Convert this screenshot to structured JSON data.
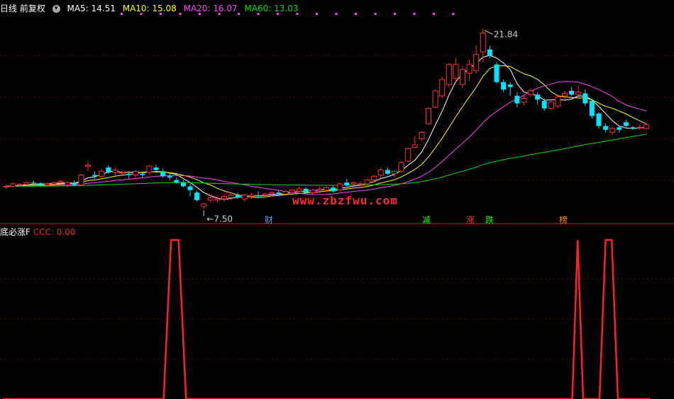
{
  "header": {
    "period_label": "日线 前复权",
    "menu_icon": "chevron-down-icon",
    "ma_labels": [
      {
        "label": "MA5: 14.51",
        "color": "#ffffff"
      },
      {
        "label": "MA10: 15.08",
        "color": "#ffff00"
      },
      {
        "label": "MA20: 16.07",
        "color": "#ff40ff"
      },
      {
        "label": "MA60: 13.03",
        "color": "#00dd00"
      }
    ]
  },
  "indicator": {
    "name": "底必涨F",
    "value_label": "CCC: 0.00",
    "value_color": "#ff2020"
  },
  "watermark": "www.zbzfwu.com",
  "events": [
    {
      "text": "财",
      "color": "#4da6ff"
    },
    {
      "text": "减",
      "color": "#00ff00"
    },
    {
      "text": "涨",
      "color": "#ff3030"
    },
    {
      "text": "跌",
      "color": "#00ff00"
    },
    {
      "text": "榜",
      "color": "#ff8c00"
    }
  ],
  "chart_data": [
    {
      "type": "candlestick",
      "title": "日线 前复权",
      "up_color": "#ff3030",
      "down_color": "#00e5ff",
      "ylim": [
        6.5,
        23
      ],
      "annotations": [
        {
          "label": "21.84",
          "type": "high"
        },
        {
          "label": "7.50",
          "type": "low"
        }
      ],
      "candles": [
        [
          9.3,
          9.45,
          9.1,
          9.3
        ],
        [
          9.3,
          9.6,
          9.2,
          9.5
        ],
        [
          9.4,
          9.55,
          9.3,
          9.45
        ],
        [
          9.45,
          9.7,
          9.35,
          9.6
        ],
        [
          9.6,
          9.75,
          9.45,
          9.55
        ],
        [
          9.5,
          9.65,
          9.3,
          9.4
        ],
        [
          9.4,
          9.6,
          9.3,
          9.5
        ],
        [
          9.5,
          9.7,
          9.4,
          9.6
        ],
        [
          9.6,
          9.8,
          9.5,
          9.7
        ],
        [
          9.4,
          9.7,
          9.2,
          9.6
        ],
        [
          9.6,
          9.8,
          9.3,
          9.4
        ],
        [
          9.4,
          10.3,
          9.3,
          10.2
        ],
        [
          10.9,
          11.3,
          10.5,
          11.0
        ],
        [
          10.2,
          10.5,
          9.9,
          10.1
        ],
        [
          10.1,
          10.7,
          10.0,
          10.5
        ],
        [
          10.8,
          11.0,
          10.3,
          10.4
        ],
        [
          10.4,
          10.8,
          10.0,
          10.6
        ],
        [
          10.4,
          10.6,
          10.1,
          10.4
        ],
        [
          10.3,
          10.5,
          9.9,
          10.2
        ],
        [
          10.2,
          10.6,
          10.0,
          10.5
        ],
        [
          10.3,
          10.5,
          10.0,
          10.2
        ],
        [
          10.4,
          11.0,
          10.2,
          10.9
        ],
        [
          10.8,
          11.0,
          10.5,
          10.6
        ],
        [
          10.5,
          10.7,
          10.0,
          10.1
        ],
        [
          10.1,
          10.3,
          9.8,
          10.0
        ],
        [
          9.8,
          10.0,
          9.5,
          9.6
        ],
        [
          9.6,
          9.8,
          9.2,
          9.3
        ],
        [
          9.3,
          9.5,
          8.5,
          9.0
        ],
        [
          8.8,
          8.95,
          8.1,
          8.2
        ],
        [
          7.7,
          8.0,
          7.5,
          7.9
        ],
        [
          8.2,
          8.6,
          8.0,
          8.4
        ],
        [
          8.2,
          8.5,
          8.0,
          8.3
        ],
        [
          8.3,
          8.6,
          8.1,
          8.5
        ],
        [
          8.4,
          8.7,
          8.2,
          8.6
        ],
        [
          8.6,
          8.8,
          8.3,
          8.4
        ],
        [
          8.3,
          8.7,
          8.1,
          8.6
        ],
        [
          8.5,
          8.8,
          8.3,
          8.6
        ],
        [
          8.6,
          8.9,
          8.4,
          8.5
        ],
        [
          8.6,
          8.8,
          8.4,
          8.7
        ],
        [
          8.7,
          8.9,
          8.5,
          8.8
        ],
        [
          8.8,
          9.0,
          8.6,
          8.7
        ],
        [
          8.7,
          9.0,
          8.6,
          8.9
        ],
        [
          8.8,
          9.1,
          8.7,
          9.0
        ],
        [
          8.9,
          9.3,
          8.8,
          9.1
        ],
        [
          9.1,
          9.2,
          8.7,
          8.8
        ],
        [
          8.8,
          9.1,
          8.6,
          9.0
        ],
        [
          9.0,
          9.3,
          8.9,
          9.1
        ],
        [
          9.0,
          9.3,
          8.9,
          9.2
        ],
        [
          9.2,
          9.3,
          8.8,
          8.9
        ],
        [
          9.0,
          9.6,
          8.9,
          9.5
        ],
        [
          9.6,
          9.9,
          9.3,
          9.4
        ],
        [
          9.5,
          9.7,
          9.3,
          9.6
        ],
        [
          9.5,
          9.7,
          9.3,
          9.5
        ],
        [
          9.5,
          9.9,
          9.4,
          9.8
        ],
        [
          9.8,
          10.2,
          9.6,
          10.1
        ],
        [
          10.2,
          10.8,
          10.0,
          10.6
        ],
        [
          10.6,
          10.8,
          10.2,
          10.3
        ],
        [
          10.3,
          10.6,
          10.0,
          10.5
        ],
        [
          10.5,
          11.3,
          10.4,
          11.2
        ],
        [
          11.3,
          12.4,
          11.2,
          12.3
        ],
        [
          12.4,
          13.3,
          12.3,
          12.6
        ],
        [
          13.1,
          13.7,
          12.9,
          13.6
        ],
        [
          14.3,
          15.6,
          14.2,
          15.5
        ],
        [
          15.6,
          17.0,
          15.5,
          16.9
        ],
        [
          16.5,
          18.0,
          16.3,
          17.8
        ],
        [
          17.4,
          19.1,
          17.2,
          19.0
        ],
        [
          17.9,
          19.5,
          17.5,
          19.0
        ],
        [
          17.4,
          18.9,
          17.1,
          18.6
        ],
        [
          18.3,
          19.4,
          17.7,
          19.0
        ],
        [
          18.5,
          20.5,
          18.3,
          19.8
        ],
        [
          20.0,
          21.84,
          19.2,
          21.5
        ],
        [
          20.2,
          20.5,
          19.5,
          19.7
        ],
        [
          19.0,
          19.2,
          17.5,
          17.6
        ],
        [
          17.6,
          17.8,
          16.8,
          17.0
        ],
        [
          17.4,
          17.6,
          16.5,
          17.2
        ],
        [
          16.5,
          16.8,
          15.6,
          15.9
        ],
        [
          16.0,
          16.6,
          15.7,
          16.3
        ],
        [
          16.6,
          17.1,
          16.4,
          16.9
        ],
        [
          16.6,
          16.8,
          15.8,
          16.2
        ],
        [
          16.1,
          16.3,
          15.3,
          15.5
        ],
        [
          15.5,
          16.1,
          15.4,
          16.0
        ],
        [
          15.7,
          16.6,
          15.5,
          16.4
        ],
        [
          16.5,
          16.9,
          16.2,
          16.7
        ],
        [
          16.9,
          17.2,
          16.5,
          16.6
        ],
        [
          16.6,
          17.3,
          16.4,
          16.8
        ],
        [
          16.7,
          17.0,
          15.7,
          15.9
        ],
        [
          16.1,
          16.3,
          14.7,
          14.9
        ],
        [
          15.1,
          15.2,
          13.9,
          14.1
        ],
        [
          14.1,
          14.3,
          13.6,
          13.8
        ],
        [
          13.6,
          14.0,
          13.4,
          13.9
        ],
        [
          14.0,
          14.1,
          13.6,
          13.8
        ],
        [
          14.4,
          14.6,
          14.0,
          14.1
        ],
        [
          14.0,
          14.1,
          13.8,
          13.9
        ],
        [
          14.0,
          14.2,
          13.8,
          14.0
        ],
        [
          13.9,
          14.3,
          13.8,
          14.2
        ]
      ],
      "series": [
        {
          "name": "MA5",
          "color": "#ffffff",
          "period": 5
        },
        {
          "name": "MA10",
          "color": "#ffff00",
          "period": 10
        },
        {
          "name": "MA20",
          "color": "#ff40ff",
          "period": 20
        },
        {
          "name": "MA60",
          "color": "#00dd00",
          "period": 60
        }
      ]
    },
    {
      "type": "line",
      "title": "底必涨F",
      "series": [
        {
          "name": "CCC",
          "color": "#ff2020"
        }
      ],
      "ylim": [
        0,
        1
      ],
      "x_range": [
        0,
        95
      ],
      "points": [
        [
          0,
          0
        ],
        [
          23.6,
          0
        ],
        [
          24.7,
          1
        ],
        [
          25.8,
          1
        ],
        [
          26.9,
          0
        ],
        [
          83.6,
          0
        ],
        [
          84.4,
          1
        ],
        [
          85.2,
          0
        ],
        [
          87.6,
          0
        ],
        [
          88.5,
          1
        ],
        [
          89.4,
          1
        ],
        [
          90.3,
          0
        ],
        [
          95,
          0
        ]
      ]
    }
  ]
}
